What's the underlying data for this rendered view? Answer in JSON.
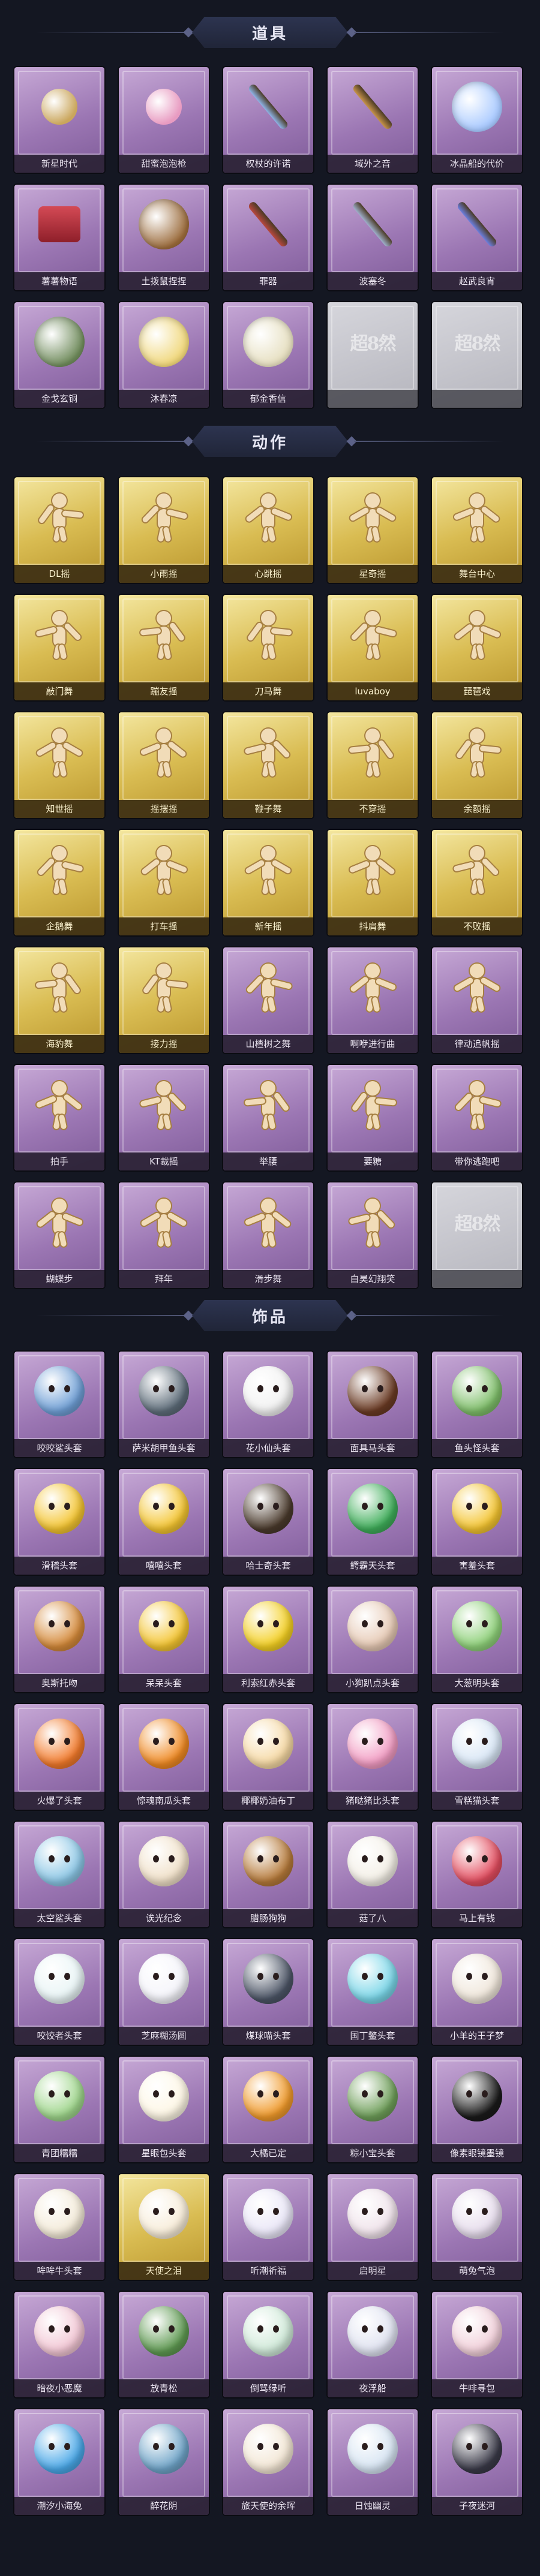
{
  "sections": {
    "props": {
      "title": "道具",
      "items": [
        {
          "label": "新星时代",
          "style": "purple",
          "icon": "revolver-icon",
          "color": "#caa65c"
        },
        {
          "label": "甜蜜泡泡枪",
          "style": "purple",
          "icon": "bubble-gun-icon",
          "color": "#e89bc1"
        },
        {
          "label": "权杖的许诺",
          "style": "purple",
          "icon": "scepter-icon",
          "color": "#8fb4e8"
        },
        {
          "label": "域外之音",
          "style": "purple",
          "icon": "guitar-icon",
          "color": "#c7944a"
        },
        {
          "label": "冰晶船的代价",
          "style": "purple",
          "icon": "ice-crystal-icon",
          "color": "#a8c9ff"
        },
        {
          "label": "薯薯物语",
          "style": "purple",
          "icon": "medkit-box-icon",
          "color": "#d44a55"
        },
        {
          "label": "土拨鼠捏捏",
          "style": "purple",
          "icon": "groundhog-icon",
          "color": "#9a6a3a"
        },
        {
          "label": "罪器",
          "style": "purple",
          "icon": "spear-icon",
          "color": "#b9483f"
        },
        {
          "label": "波塞冬",
          "style": "purple",
          "icon": "trident-icon",
          "color": "#9fb0cc"
        },
        {
          "label": "赵武良宵",
          "style": "purple",
          "icon": "magic-staff-icon",
          "color": "#6c7fe0"
        },
        {
          "label": "金戈玄铜",
          "style": "purple",
          "icon": "grenade-icon",
          "color": "#6e8a5a"
        },
        {
          "label": "沐春凉",
          "style": "purple",
          "icon": "flower-wreath-icon",
          "color": "#f0d77a"
        },
        {
          "label": "郁金香信",
          "style": "purple",
          "icon": "parasol-icon",
          "color": "#e6dfc0"
        },
        {
          "label": "",
          "style": "grey",
          "icon": "locked-placeholder-icon",
          "color": "#c8c8cf"
        },
        {
          "label": "",
          "style": "grey",
          "icon": "locked-placeholder-icon",
          "color": "#c8c8cf"
        }
      ]
    },
    "actions": {
      "title": "动作",
      "items": [
        {
          "label": "DL摇",
          "style": "gold"
        },
        {
          "label": "小雨摇",
          "style": "gold"
        },
        {
          "label": "心跳摇",
          "style": "gold"
        },
        {
          "label": "星奇摇",
          "style": "gold"
        },
        {
          "label": "舞台中心",
          "style": "gold"
        },
        {
          "label": "敲门舞",
          "style": "gold"
        },
        {
          "label": "蹦友摇",
          "style": "gold"
        },
        {
          "label": "刀马舞",
          "style": "gold"
        },
        {
          "label": "luvaboy",
          "style": "gold"
        },
        {
          "label": "琵琶戏",
          "style": "gold"
        },
        {
          "label": "知世摇",
          "style": "gold"
        },
        {
          "label": "摇摆摇",
          "style": "gold"
        },
        {
          "label": "鞭子舞",
          "style": "gold"
        },
        {
          "label": "不穿摇",
          "style": "gold"
        },
        {
          "label": "余额摇",
          "style": "gold"
        },
        {
          "label": "企鹅舞",
          "style": "gold"
        },
        {
          "label": "打车摇",
          "style": "gold"
        },
        {
          "label": "新年摇",
          "style": "gold"
        },
        {
          "label": "抖肩舞",
          "style": "gold"
        },
        {
          "label": "不败摇",
          "style": "gold"
        },
        {
          "label": "海豹舞",
          "style": "gold"
        },
        {
          "label": "接力摇",
          "style": "gold"
        },
        {
          "label": "山楂树之舞",
          "style": "purple"
        },
        {
          "label": "啊咿进行曲",
          "style": "purple"
        },
        {
          "label": "律动追帆摇",
          "style": "purple"
        },
        {
          "label": "拍手",
          "style": "purple"
        },
        {
          "label": "KT裁摇",
          "style": "purple"
        },
        {
          "label": "举腰",
          "style": "purple"
        },
        {
          "label": "要糖",
          "style": "purple"
        },
        {
          "label": "带你逃跑吧",
          "style": "purple"
        },
        {
          "label": "蝴蝶步",
          "style": "purple"
        },
        {
          "label": "拜年",
          "style": "purple"
        },
        {
          "label": "滑步舞",
          "style": "purple"
        },
        {
          "label": "白昊幻翔笑",
          "style": "purple"
        },
        {
          "label": "",
          "style": "grey"
        }
      ]
    },
    "headwear": {
      "title": "饰品",
      "items": [
        {
          "label": "咬咬鲨头套",
          "style": "purple",
          "icon": "shark-head-icon",
          "color": "#6f9fd6"
        },
        {
          "label": "萨米胡甲鱼头套",
          "style": "purple",
          "icon": "turtle-head-icon",
          "color": "#5e6d7a"
        },
        {
          "label": "花小仙头套",
          "style": "purple",
          "icon": "panda-head-icon",
          "color": "#f1f1f1"
        },
        {
          "label": "面具马头套",
          "style": "purple",
          "icon": "horse-head-icon",
          "color": "#6b3b24"
        },
        {
          "label": "鱼头怪头套",
          "style": "purple",
          "icon": "fish-head-icon",
          "color": "#7fbf6a"
        },
        {
          "label": "滑稽头套",
          "style": "purple",
          "icon": "smirk-emoji-icon",
          "color": "#f4c531"
        },
        {
          "label": "嘻嘻头套",
          "style": "purple",
          "icon": "grin-emoji-icon",
          "color": "#f4c531"
        },
        {
          "label": "哈士奇头套",
          "style": "purple",
          "icon": "husky-head-icon",
          "color": "#4a3a2c"
        },
        {
          "label": "鳄霸天头套",
          "style": "purple",
          "icon": "crocodile-head-icon",
          "color": "#3fae5a"
        },
        {
          "label": "害羞头套",
          "style": "purple",
          "icon": "shy-emoji-icon",
          "color": "#f4c531"
        },
        {
          "label": "奥斯托吻",
          "style": "purple",
          "icon": "toast-head-icon",
          "color": "#d58a3a"
        },
        {
          "label": "呆呆头套",
          "style": "purple",
          "icon": "daze-emoji-icon",
          "color": "#f4c531"
        },
        {
          "label": "利索红赤头套",
          "style": "purple",
          "icon": "pikachu-head-icon",
          "color": "#f4d023"
        },
        {
          "label": "小狗趴点头套",
          "style": "purple",
          "icon": "puppy-head-icon",
          "color": "#e6c9b4"
        },
        {
          "label": "大葱明头套",
          "style": "purple",
          "icon": "scallion-head-icon",
          "color": "#8fd17a"
        },
        {
          "label": "火爆了头套",
          "style": "purple",
          "icon": "flame-head-icon",
          "color": "#f27a2b"
        },
        {
          "label": "惊魂南瓜头套",
          "style": "purple",
          "icon": "pumpkin-head-icon",
          "color": "#f08a23"
        },
        {
          "label": "椰椰奶油布丁",
          "style": "purple",
          "icon": "pudding-head-icon",
          "color": "#f6d9a4"
        },
        {
          "label": "猪哒猪比头套",
          "style": "purple",
          "icon": "pig-head-icon",
          "color": "#f29cc3"
        },
        {
          "label": "雪糕猫头套",
          "style": "purple",
          "icon": "snow-cat-head-icon",
          "color": "#d8e6f5"
        },
        {
          "label": "太空鲨头套",
          "style": "purple",
          "icon": "space-shark-head-icon",
          "color": "#8cc7e6"
        },
        {
          "label": "诶光纪念",
          "style": "purple",
          "icon": "candle-head-icon",
          "color": "#f0e0c8"
        },
        {
          "label": "腊肠狗狗",
          "style": "purple",
          "icon": "dachshund-head-icon",
          "color": "#b67a3a"
        },
        {
          "label": "菇了八",
          "style": "purple",
          "icon": "dumpling-head-icon",
          "color": "#f3efe6"
        },
        {
          "label": "马上有钱",
          "style": "purple",
          "icon": "chick-head-icon",
          "color": "#e34d5f"
        },
        {
          "label": "咬饺者头套",
          "style": "purple",
          "icon": "cloud-head-icon",
          "color": "#e8f4f5"
        },
        {
          "label": "芝麻糊汤圆",
          "style": "purple",
          "icon": "tangyuan-head-icon",
          "color": "#f4f4fa"
        },
        {
          "label": "煤球喵头套",
          "style": "purple",
          "icon": "black-cat-head-icon",
          "color": "#4c5566"
        },
        {
          "label": "国丁鳖头套",
          "style": "purple",
          "icon": "miku-head-icon",
          "color": "#7ad6e8"
        },
        {
          "label": "小羊的王子梦",
          "style": "purple",
          "icon": "sheep-prince-head-icon",
          "color": "#efe6da"
        },
        {
          "label": "青团糯糯",
          "style": "purple",
          "icon": "green-dumpling-head-icon",
          "color": "#9fd68c"
        },
        {
          "label": "星眼包头套",
          "style": "purple",
          "icon": "bun-head-icon",
          "color": "#fdf6e4"
        },
        {
          "label": "大橘已定",
          "style": "purple",
          "icon": "orange-head-icon",
          "color": "#f09a2b"
        },
        {
          "label": "粽小宝头套",
          "style": "purple",
          "icon": "zongzi-head-icon",
          "color": "#6f9f5a"
        },
        {
          "label": "像素眼镜墨镜",
          "style": "purple",
          "icon": "pixel-sunglasses-icon",
          "color": "#1a1a1a"
        },
        {
          "label": "哞哞牛头套",
          "style": "purple",
          "icon": "cow-head-icon",
          "color": "#f3ead8"
        },
        {
          "label": "天使之泪",
          "style": "gold",
          "icon": "angel-head-icon",
          "color": "#f7ecd8"
        },
        {
          "label": "听潮祈福",
          "style": "purple",
          "icon": "wing-head-icon",
          "color": "#e9e6f7"
        },
        {
          "label": "启明星",
          "style": "purple",
          "icon": "blank-head-icon",
          "color": "#efe2ea"
        },
        {
          "label": "萌兔气泡",
          "style": "purple",
          "icon": "bubble-head-icon",
          "color": "#e6dcec"
        },
        {
          "label": "暗夜小恶魔",
          "style": "purple",
          "icon": "imp-head-icon",
          "color": "#f2c6d4"
        },
        {
          "label": "放青松",
          "style": "purple",
          "icon": "bonsai-head-icon",
          "color": "#5f9a52"
        },
        {
          "label": "倒骂绿听",
          "style": "purple",
          "icon": "jade-head-icon",
          "color": "#cfe9d8"
        },
        {
          "label": "夜浮船",
          "style": "purple",
          "icon": "night-boat-head-icon",
          "color": "#dfe2f0"
        },
        {
          "label": "牛啡寻包",
          "style": "purple",
          "icon": "cake-head-icon",
          "color": "#f1cfd9"
        },
        {
          "label": "潮汐小海兔",
          "style": "purple",
          "icon": "blue-cat-head-icon",
          "color": "#4aa8e8"
        },
        {
          "label": "醉花阴",
          "style": "purple",
          "icon": "floral-girl-icon",
          "color": "#6fa4c8"
        },
        {
          "label": "旅天使的余晖",
          "style": "purple",
          "icon": "angel-girl-icon",
          "color": "#f2e6d4"
        },
        {
          "label": "日蚀幽灵",
          "style": "purple",
          "icon": "ghost-head-icon",
          "color": "#d6e4f2"
        },
        {
          "label": "子夜迷河",
          "style": "purple",
          "icon": "dark-girl-icon",
          "color": "#3a3a48"
        }
      ]
    }
  },
  "placeholder_mark": "超8然"
}
